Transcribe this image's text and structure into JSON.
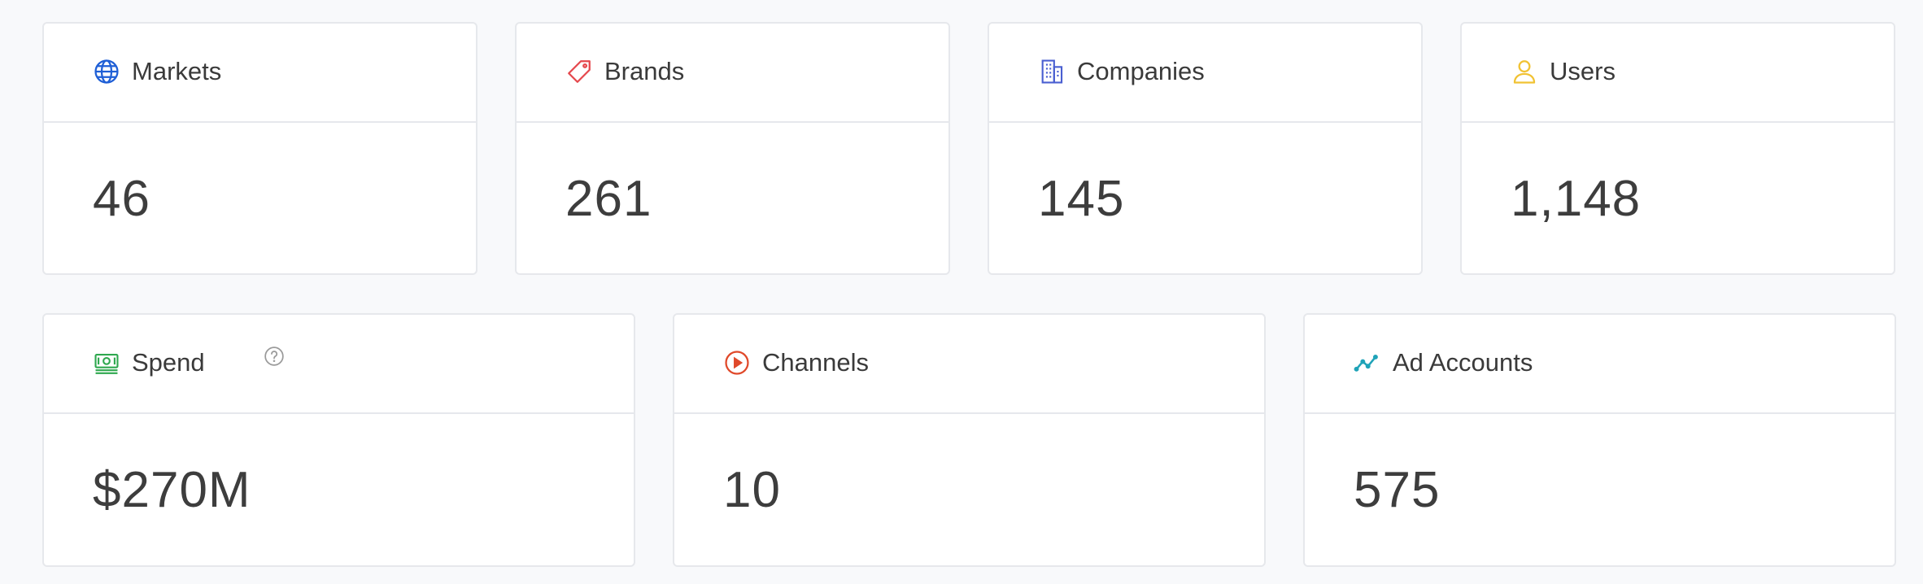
{
  "colors": {
    "background": "#f8f9fb",
    "card_border": "#e6e8ec",
    "markets_icon": "#1f5fd6",
    "brands_icon": "#e5484d",
    "companies_icon": "#4a5fd1",
    "users_icon": "#f1c233",
    "spend_icon": "#2fa84f",
    "channels_icon": "#e0492a",
    "ad_accounts_icon": "#1fa3b8",
    "help_icon": "#9a9a9a"
  },
  "cards": {
    "markets": {
      "icon": "globe-icon",
      "title": "Markets",
      "value": "46"
    },
    "brands": {
      "icon": "tag-icon",
      "title": "Brands",
      "value": "261"
    },
    "companies": {
      "icon": "building-icon",
      "title": "Companies",
      "value": "145"
    },
    "users": {
      "icon": "user-icon",
      "title": "Users",
      "value": "1,148"
    },
    "spend": {
      "icon": "cash-icon",
      "title": "Spend",
      "value": "$270M",
      "help_icon": "question-circle-icon"
    },
    "channels": {
      "icon": "play-circle-icon",
      "title": "Channels",
      "value": "10"
    },
    "ad_accounts": {
      "icon": "trend-line-icon",
      "title": "Ad Accounts",
      "value": "575"
    }
  }
}
